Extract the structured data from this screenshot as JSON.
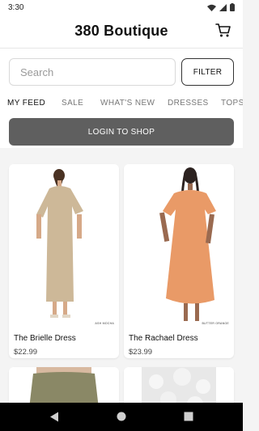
{
  "status": {
    "time": "3:30"
  },
  "header": {
    "title": "380 Boutique",
    "cart_icon": "shopping-cart-icon"
  },
  "search": {
    "placeholder": "Search",
    "value": ""
  },
  "filter": {
    "label": "FILTER"
  },
  "tabs": [
    {
      "label": "MY FEED",
      "active": true
    },
    {
      "label": "SALE"
    },
    {
      "label": "WHAT'S NEW"
    },
    {
      "label": "DRESSES"
    },
    {
      "label": "TOPS"
    }
  ],
  "login": {
    "label": "LOGIN TO SHOP"
  },
  "products": [
    {
      "name": "The Brielle Dress",
      "price": "$22.99",
      "color_tag": "ASH MOCHA",
      "dress_color": "#cdb898"
    },
    {
      "name": "The Rachael Dress",
      "price": "$23.99",
      "color_tag": "BUTTER ORANGE",
      "dress_color": "#e99a67"
    },
    {
      "name": "",
      "price": "",
      "color_tag": "",
      "dress_color": "#8a8866"
    },
    {
      "name": "",
      "price": "",
      "color_tag": "",
      "dress_color": "#e8e8e8"
    }
  ],
  "colors": {
    "accent": "#5f5f5f",
    "background": "#f4f4f4"
  }
}
